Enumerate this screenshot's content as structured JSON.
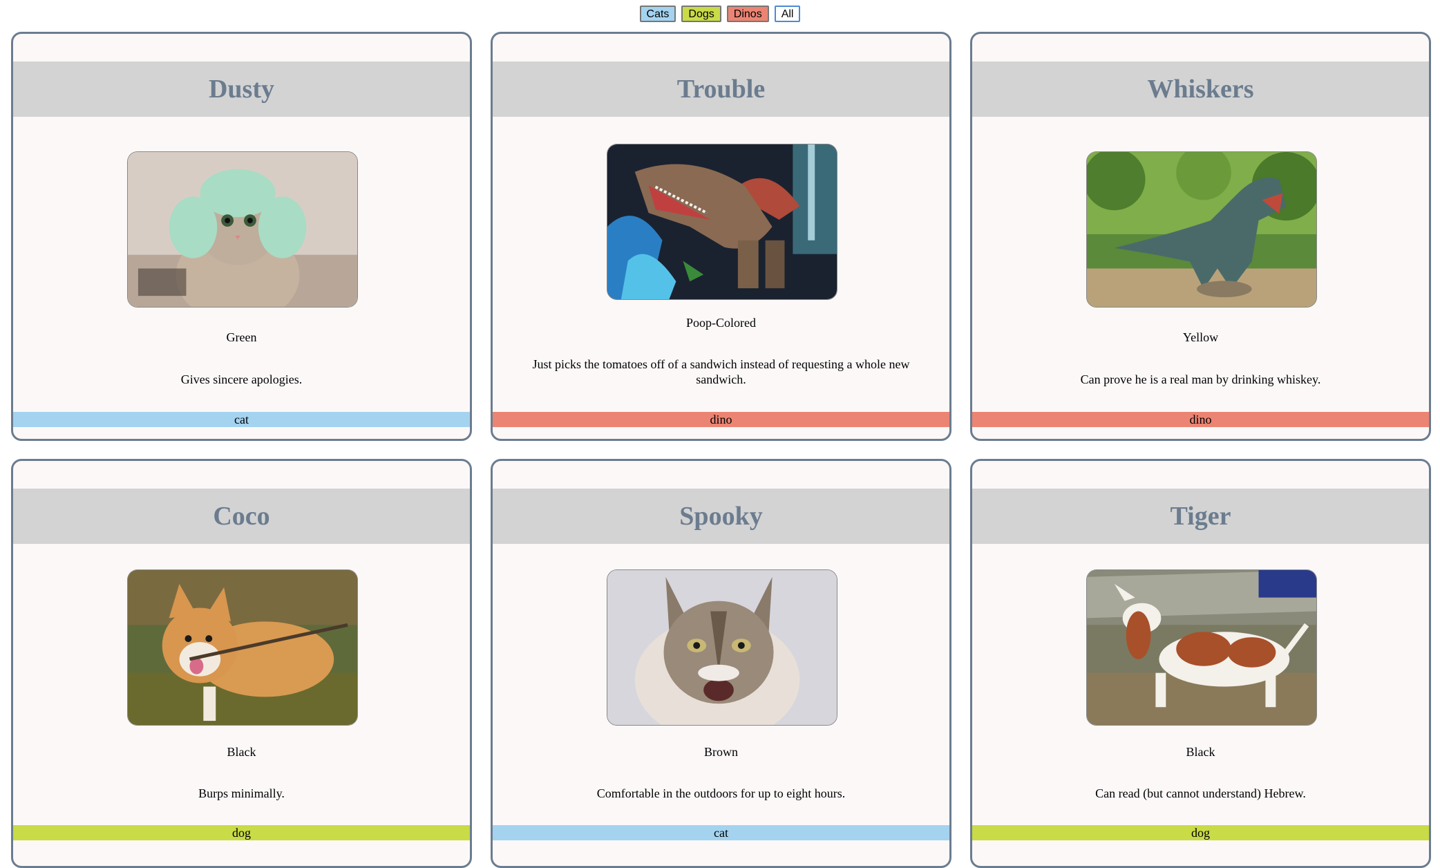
{
  "filters": [
    {
      "label": "Cats",
      "color": "#a4d3f0"
    },
    {
      "label": "Dogs",
      "color": "#c9db46"
    },
    {
      "label": "Dinos",
      "color": "#ec8473"
    },
    {
      "label": "All",
      "color": "#ffffff"
    }
  ],
  "type_colors": {
    "cat": "#a4d3f0",
    "dog": "#c9db46",
    "dino": "#ec8473"
  },
  "cards": [
    {
      "name": "Dusty",
      "color": "Green",
      "description": "Gives sincere apologies.",
      "type": "cat"
    },
    {
      "name": "Trouble",
      "color": "Poop-Colored",
      "description": "Just picks the tomatoes off of a sandwich instead of requesting a whole new sandwich.",
      "type": "dino"
    },
    {
      "name": "Whiskers",
      "color": "Yellow",
      "description": "Can prove he is a real man by drinking whiskey.",
      "type": "dino"
    },
    {
      "name": "Coco",
      "color": "Black",
      "description": "Burps minimally.",
      "type": "dog"
    },
    {
      "name": "Spooky",
      "color": "Brown",
      "description": "Comfortable in the outdoors for up to eight hours.",
      "type": "cat"
    },
    {
      "name": "Tiger",
      "color": "Black",
      "description": "Can read (but cannot understand) Hebrew.",
      "type": "dog"
    }
  ]
}
